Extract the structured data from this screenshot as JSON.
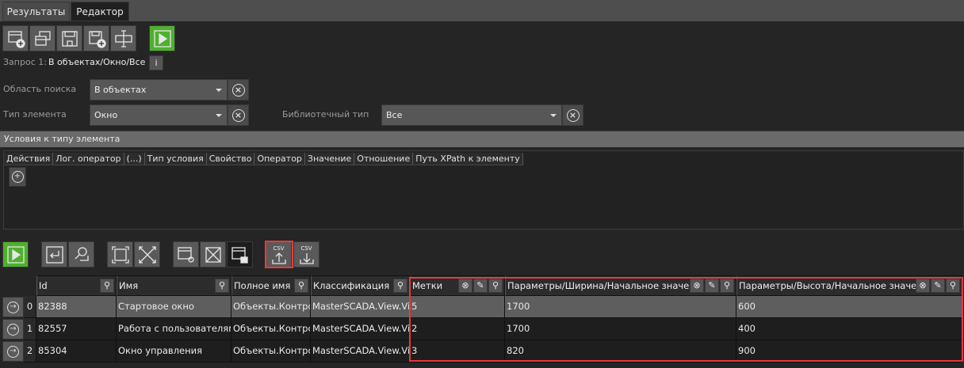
{
  "tabs": [
    {
      "label": "Результаты",
      "active": false
    },
    {
      "label": "Редактор",
      "active": true
    }
  ],
  "toolbar": {
    "icons": [
      "new-window-add-icon",
      "windows-icon",
      "save-icon",
      "save-add-icon",
      "text-cursor-icon",
      "play-icon"
    ]
  },
  "query": {
    "label": "Запрос 1:",
    "value": "В объектах/Окно/Все",
    "info": "i"
  },
  "form": {
    "search_area": {
      "label": "Область поиска",
      "value": "В объектах"
    },
    "element_type": {
      "label": "Тип элемента",
      "value": "Окно"
    },
    "library_type": {
      "label": "Библиотечный тип",
      "value": "Все"
    }
  },
  "conditions": {
    "title": "Условия к типу элемента",
    "columns": [
      "Действия",
      "Лог. оператор",
      "(...)",
      "Тип условия",
      "Свойство",
      "Оператор",
      "Значение",
      "Отношение",
      "Путь XPath к элементу"
    ]
  },
  "results_toolbar": {
    "csv_export": "CSV",
    "csv_import": "CSV"
  },
  "grid": {
    "columns": [
      "Id",
      "Имя",
      "Полное имя",
      "Классификация",
      "Метки",
      "Параметры/Ширина/Начальное значени",
      "Параметры/Высота/Начальное значен"
    ],
    "rows": [
      {
        "index": "0",
        "id": "82388",
        "name": "Стартовое окно",
        "full_name": "Объекты.Контрол",
        "class": "MasterSCADA.View.View",
        "tags": "5",
        "width": "1700",
        "height": "600"
      },
      {
        "index": "1",
        "id": "82557",
        "name": "Работа с пользователями",
        "full_name": "Объекты.Контрол",
        "class": "MasterSCADA.View.View",
        "tags": "2",
        "width": "1700",
        "height": "400"
      },
      {
        "index": "2",
        "id": "85304",
        "name": "Окно управления",
        "full_name": "Объекты.Контрол",
        "class": "MasterSCADA.View.View",
        "tags": "3",
        "width": "820",
        "height": "900"
      }
    ]
  },
  "colors": {
    "accent_green": "#4fb02e",
    "highlight_red": "#e8383d"
  }
}
